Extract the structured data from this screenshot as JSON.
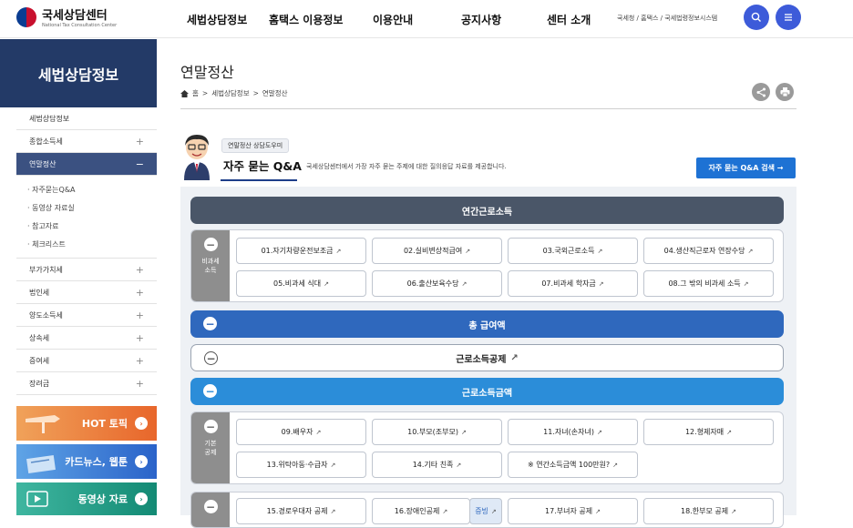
{
  "header": {
    "logo_title": "국세상담센터",
    "logo_sub": "National Tax Consultation Center",
    "nav": [
      "세법상담정보",
      "홈택스 이용정보",
      "이용안내",
      "공지사항",
      "센터 소개"
    ],
    "util_links": "국세청 / 홈택스 / 국세법령정보시스템"
  },
  "sidebar": {
    "heading": "세법상담정보",
    "items": [
      {
        "label": "세법상담정보",
        "pm": ""
      },
      {
        "label": "종합소득세",
        "pm": "+"
      },
      {
        "label": "연말정산",
        "pm": "−"
      },
      {
        "label": "부가가치세",
        "pm": "+"
      },
      {
        "label": "법인세",
        "pm": "+"
      },
      {
        "label": "양도소득세",
        "pm": "+"
      },
      {
        "label": "상속세",
        "pm": "+"
      },
      {
        "label": "증여세",
        "pm": "+"
      },
      {
        "label": "장려금",
        "pm": "+"
      }
    ],
    "subs": [
      "· 자주묻는Q&A",
      "· 동영상 자료실",
      "· 참고자료",
      "· 체크리스트"
    ],
    "banners": [
      "HOT 토픽",
      "카드뉴스, 웹툰",
      "동영상 자료"
    ],
    "banner_arrow": "›"
  },
  "main": {
    "title": "연말정산",
    "breadcrumb": [
      "홈",
      ">",
      "세법상담정보",
      ">",
      "연말정산"
    ],
    "helper_tag": "연말정산 상담도우미",
    "qa_title": "자주 묻는 Q&A",
    "qa_desc": "국세상담센터에서 가장 자주 묻는 주제에 대한 질의응답 자료를 제공합니다.",
    "qa_button": "자주 묻는 Q&A 검색 →",
    "ext_icon": "↗"
  },
  "sections": {
    "annual_income": "연간근로소득",
    "nontax_label": "비과세\n소득",
    "nontax": [
      "01.자기차량운전보조금",
      "02.실비변상적급여",
      "03.국외근로소득",
      "04.생산직근로자 연장수당",
      "05.비과세 식대",
      "06.출산보육수당",
      "07.비과세 학자금",
      "08.그 밖의 비과세 소득"
    ],
    "total_pay": "총 급여액",
    "earned_deduction": "근로소득공제",
    "earned_amount": "근로소득금액",
    "basic_label": "기본\n공제",
    "basic": [
      "09.배우자",
      "10.부모(조부모)",
      "11.자녀(손자녀)",
      "12.형제자매",
      "13.위탁아동·수급자",
      "14.기타 친족",
      "※ 연간소득금액 100만원?"
    ],
    "extra": [
      "15.경로우대자 공제",
      "16.장애인공제",
      "증빙",
      "17.부녀자 공제",
      "18.한부모 공제"
    ]
  },
  "colors": {
    "navy": "#233a67",
    "accent_blue": "#1e72d4",
    "bar_blue": "#2f68bd"
  }
}
